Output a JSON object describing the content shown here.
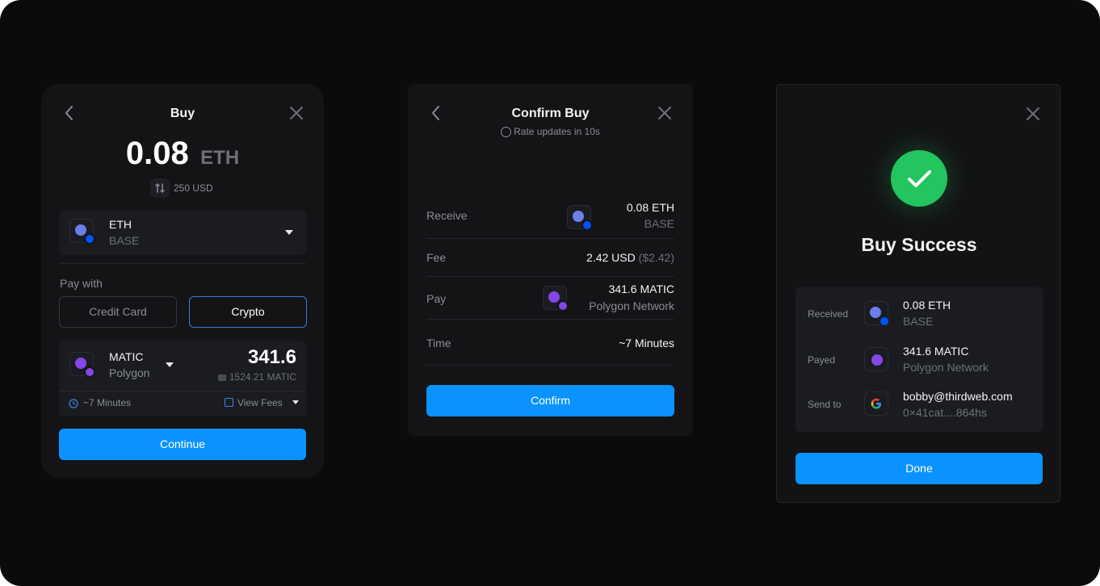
{
  "buy": {
    "title": "Buy",
    "amount": "0.08",
    "amount_token": "ETH",
    "usd_value": "250 USD",
    "receive_token": {
      "symbol": "ETH",
      "chain": "BASE"
    },
    "pay_with_label": "Pay with",
    "tabs": [
      "Credit Card",
      "Crypto"
    ],
    "selected_tab": "Crypto",
    "pay_token": {
      "symbol": "MATIC",
      "chain": "Polygon"
    },
    "pay_amount": "341.6",
    "balance": "1524.21 MATIC",
    "time_estimate": "~7 Minutes",
    "view_fees": "View Fees",
    "continue_label": "Continue"
  },
  "confirm": {
    "title": "Confirm Buy",
    "rate_text": "Rate updates in",
    "rate_seconds": "10s",
    "rows": {
      "receive": {
        "label": "Receive",
        "value": "0.08 ETH",
        "sub": "BASE"
      },
      "fee": {
        "label": "Fee",
        "value": "2.42 USD",
        "sub": "($2.42)"
      },
      "pay": {
        "label": "Pay",
        "value": "341.6 MATIC",
        "sub": "Polygon Network"
      },
      "time": {
        "label": "Time",
        "value": "~7 Minutes"
      }
    },
    "confirm_label": "Confirm"
  },
  "success": {
    "title": "Buy Success",
    "rows": {
      "received": {
        "label": "Received",
        "value": "0.08 ETH",
        "sub": "BASE"
      },
      "payed": {
        "label": "Payed",
        "value": "341.6 MATIC",
        "sub": "Polygon Network"
      },
      "send_to": {
        "label": "Send to",
        "value": "bobby@thirdweb.com",
        "sub": "0×41cat....864hs"
      }
    },
    "done_label": "Done"
  },
  "colors": {
    "accent": "#0a93ff",
    "success": "#22c55e",
    "background": "#0b0b0c",
    "card": "#141416"
  },
  "icons": [
    "back-icon",
    "close-icon",
    "swap-icon",
    "chevron-down-icon",
    "clock-icon",
    "fees-icon",
    "wallet-icon",
    "check-icon",
    "google-icon",
    "eth-icon",
    "base-icon",
    "matic-icon"
  ]
}
